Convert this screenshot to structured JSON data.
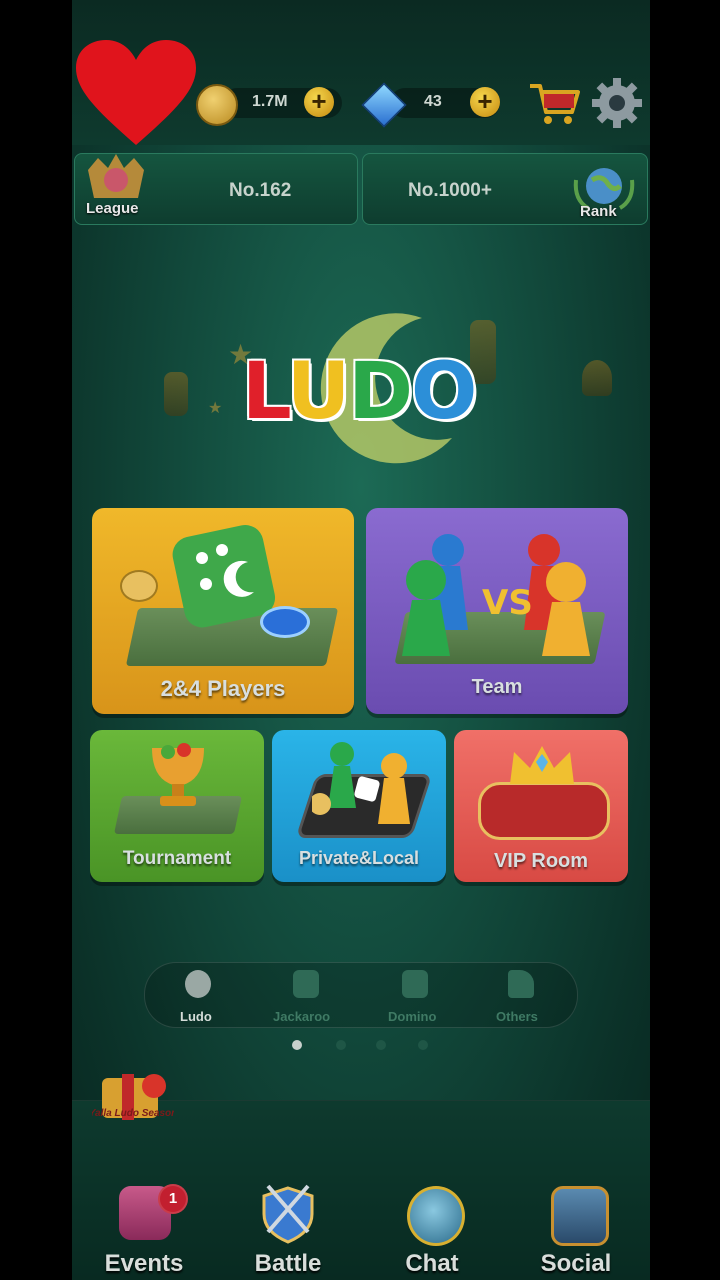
{
  "currency": {
    "coins": "1.7M",
    "gems": "43"
  },
  "ranks": {
    "league_label": "League",
    "league_value": "No.162",
    "rank_value": "No.1000+",
    "rank_label": "Rank"
  },
  "logo": {
    "text": [
      "L",
      "U",
      "D",
      "O"
    ],
    "colors": [
      "#e0202a",
      "#f0c020",
      "#2aa84a",
      "#2c8fd8"
    ]
  },
  "cards": {
    "players": "2&4 Players",
    "team": "Team",
    "tournament": "Tournament",
    "private": "Private&Local",
    "vip": "VIP Room"
  },
  "modes": [
    {
      "label": "Ludo",
      "active": true
    },
    {
      "label": "Jackaroo",
      "active": false
    },
    {
      "label": "Domino",
      "active": false
    },
    {
      "label": "Others",
      "active": false
    }
  ],
  "season_badge": "Yalla Ludo Season",
  "nav": {
    "events": "Events",
    "events_badge": "1",
    "battle": "Battle",
    "chat": "Chat",
    "social": "Social"
  },
  "colors": {
    "bg_dark": "#0b3128",
    "card_yellow": "#e8a21c",
    "card_purple": "#7a5bc0",
    "card_green": "#5aa62a",
    "card_blue": "#1aa3d6",
    "card_red": "#e0584e"
  }
}
